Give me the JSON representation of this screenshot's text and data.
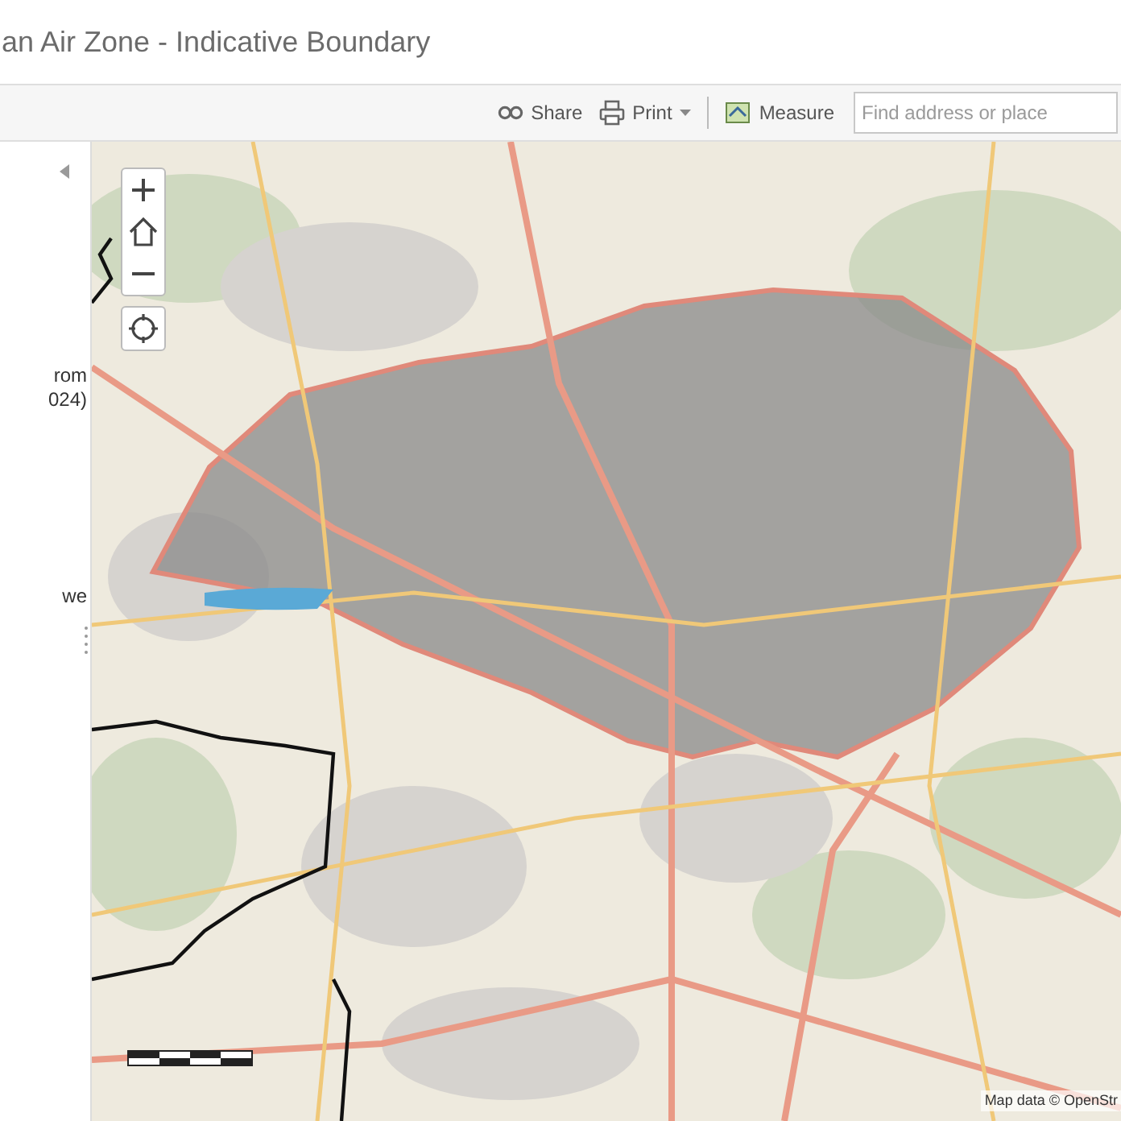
{
  "header": {
    "title": "an Air Zone - Indicative Boundary"
  },
  "toolbar": {
    "items": [
      {
        "kind": "share",
        "label": "Share"
      },
      {
        "kind": "print",
        "label": "Print"
      },
      {
        "kind": "measure",
        "label": "Measure"
      }
    ],
    "search": {
      "placeholder": "Find address or place"
    }
  },
  "side_panel": {
    "lines": [
      "rom",
      "024)",
      "we"
    ]
  },
  "map": {
    "attribution": "Map data © OpenStr"
  }
}
